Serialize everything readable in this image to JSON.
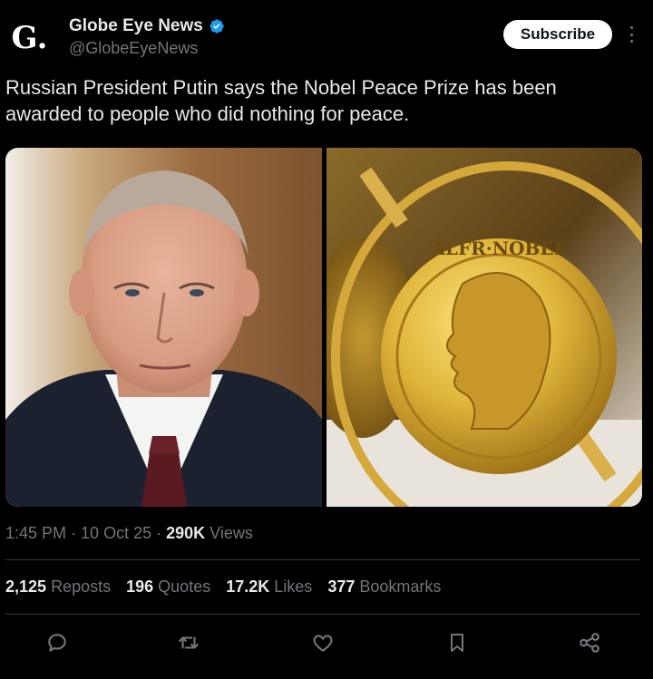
{
  "account": {
    "avatar_letter": "G",
    "display_name": "Globe Eye News",
    "handle": "@GlobeEyeNews",
    "verified_color": "#1d9bf0",
    "subscribe_label": "Subscribe"
  },
  "post": {
    "text": "Russian President Putin says the Nobel Peace Prize has been\nawarded to people who did nothing for peace.",
    "time": "1:45 PM",
    "date": "10 Oct 25",
    "views_count": "290K",
    "views_label": "Views"
  },
  "media": [
    {
      "name": "putin-photo"
    },
    {
      "name": "nobel-medal-photo",
      "medal_inscription": "ALFR·NOBEL"
    }
  ],
  "stats": {
    "reposts_count": "2,125",
    "reposts_label": "Reposts",
    "quotes_count": "196",
    "quotes_label": "Quotes",
    "likes_count": "17.2K",
    "likes_label": "Likes",
    "bookmarks_count": "377",
    "bookmarks_label": "Bookmarks"
  },
  "actions": [
    {
      "icon": "reply-icon"
    },
    {
      "icon": "repost-icon"
    },
    {
      "icon": "like-icon"
    },
    {
      "icon": "bookmark-icon"
    },
    {
      "icon": "share-icon"
    }
  ],
  "colors": {
    "background": "#000000",
    "text": "#e7e9ea",
    "muted": "#71767b",
    "divider": "#2f3336",
    "accent": "#1d9bf0"
  }
}
